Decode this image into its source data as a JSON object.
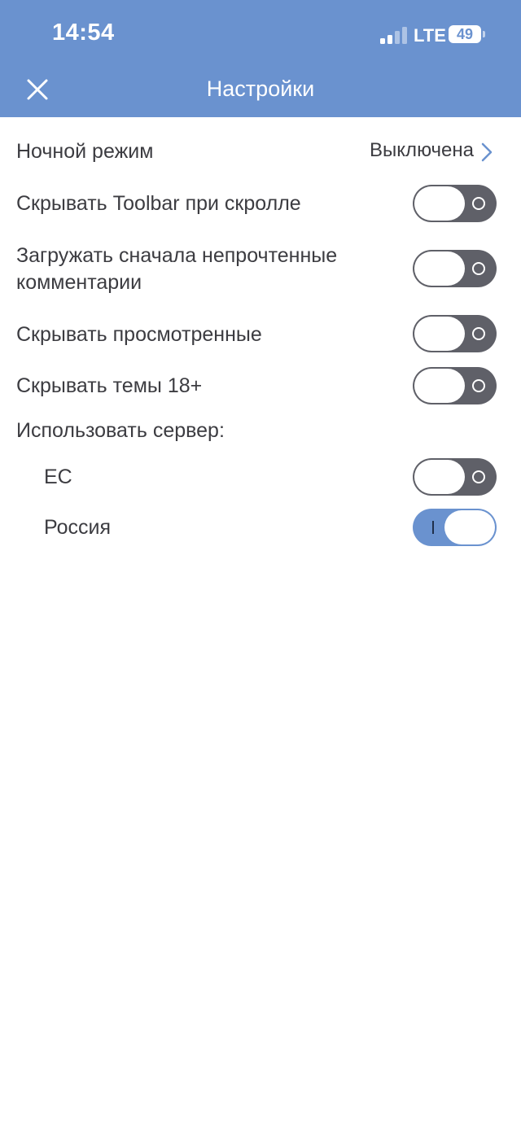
{
  "status_bar": {
    "time": "14:54",
    "network": "LTE",
    "battery": "49"
  },
  "header": {
    "title": "Настройки",
    "close_icon": "close-icon"
  },
  "settings": {
    "night_mode": {
      "label": "Ночной режим",
      "value": "Выключена"
    },
    "hide_toolbar": {
      "label": "Скрывать Toolbar при скролле",
      "enabled": false
    },
    "load_unread": {
      "label_line1": "Загружать сначала непрочтенные",
      "label_line2": "комментарии",
      "enabled": false
    },
    "hide_viewed": {
      "label": "Скрывать просмотренные",
      "enabled": false
    },
    "hide_18": {
      "label": "Скрывать темы 18+",
      "enabled": false
    },
    "server": {
      "label": "Использовать сервер:",
      "options": [
        {
          "label": "ЕС",
          "enabled": false
        },
        {
          "label": "Россия",
          "enabled": true
        }
      ]
    }
  },
  "colors": {
    "accent": "#6a92cf",
    "toggle_off": "#5f6068",
    "text": "#3c3c41"
  }
}
